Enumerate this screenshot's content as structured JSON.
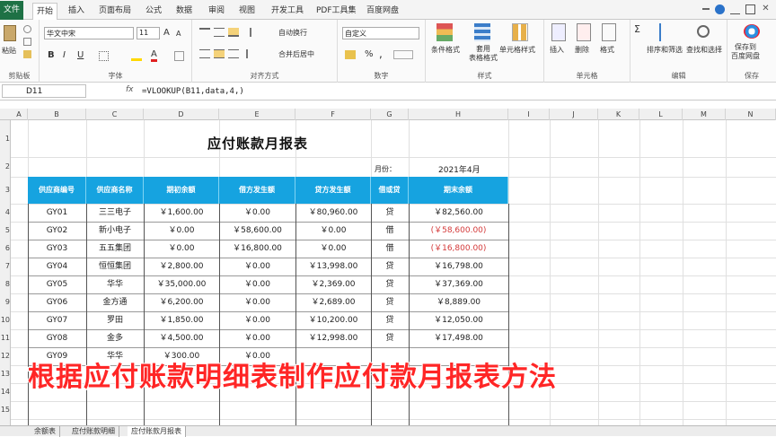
{
  "ribbon_tabs": {
    "file": "文件",
    "items": [
      "开始",
      "插入",
      "页面布局",
      "公式",
      "数据",
      "审阅",
      "视图",
      "开发工具",
      "PDF工具集",
      "百度网盘"
    ],
    "active": "开始"
  },
  "ribbon": {
    "clipboard": {
      "paste": "粘贴",
      "label": "剪贴板"
    },
    "font": {
      "name": "华文中宋",
      "size": "11",
      "label": "字体",
      "bold": "B",
      "italic": "I",
      "underline": "U",
      "font_color_glyph": "A",
      "grow": "A",
      "shrink": "A"
    },
    "align": {
      "wrap": "自动换行",
      "merge": "合并后居中",
      "label": "对齐方式"
    },
    "number": {
      "format": "自定义",
      "label": "数字",
      "percent": "%",
      "comma": ","
    },
    "styles": {
      "cond": "条件格式",
      "table": "套用\n表格格式",
      "cellstyle": "单元格样式",
      "label": "样式"
    },
    "cells": {
      "insert": "插入",
      "delete": "删除",
      "format": "格式",
      "label": "单元格"
    },
    "editing": {
      "sortfilter": "排序和筛选",
      "find": "查找和选择",
      "label": "编辑"
    },
    "save": {
      "cloud": "保存到\n百度网盘",
      "label": "保存"
    },
    "accent": "#1e7145"
  },
  "formula_bar": {
    "name_box": "D11",
    "fx": "fx",
    "formula": "=VLOOKUP(B11,data,4,)"
  },
  "columns": [
    "A",
    "B",
    "C",
    "D",
    "E",
    "F",
    "G",
    "H",
    "I",
    "J",
    "K",
    "L",
    "M",
    "N"
  ],
  "rows": [
    "1",
    "2",
    "3",
    "4",
    "5",
    "6",
    "7",
    "8",
    "9",
    "10",
    "11",
    "12",
    "13",
    "14",
    "15"
  ],
  "sheet": {
    "title": "应付账款月报表",
    "month_label": "月份：",
    "month_value": "2021年4月",
    "headers": [
      "供应商编号",
      "供应商名称",
      "期初余额",
      "借方发生额",
      "贷方发生额",
      "借或贷",
      "期末余额"
    ],
    "rows": [
      {
        "id": "GY01",
        "name": "三三电子",
        "open": "￥1,600.00",
        "debit": "￥0.00",
        "credit": "￥80,960.00",
        "dc": "贷",
        "close": "￥82,560.00",
        "neg": false
      },
      {
        "id": "GY02",
        "name": "新小电子",
        "open": "￥0.00",
        "debit": "￥58,600.00",
        "credit": "￥0.00",
        "dc": "借",
        "close": "(￥58,600.00)",
        "neg": true
      },
      {
        "id": "GY03",
        "name": "五五集团",
        "open": "￥0.00",
        "debit": "￥16,800.00",
        "credit": "￥0.00",
        "dc": "借",
        "close": "(￥16,800.00)",
        "neg": true
      },
      {
        "id": "GY04",
        "name": "恒恒集团",
        "open": "￥2,800.00",
        "debit": "￥0.00",
        "credit": "￥13,998.00",
        "dc": "贷",
        "close": "￥16,798.00",
        "neg": false
      },
      {
        "id": "GY05",
        "name": "华华",
        "open": "￥35,000.00",
        "debit": "￥0.00",
        "credit": "￥2,369.00",
        "dc": "贷",
        "close": "￥37,369.00",
        "neg": false
      },
      {
        "id": "GY06",
        "name": "金方通",
        "open": "￥6,200.00",
        "debit": "￥0.00",
        "credit": "￥2,689.00",
        "dc": "贷",
        "close": "￥8,889.00",
        "neg": false
      },
      {
        "id": "GY07",
        "name": "罗田",
        "open": "￥1,850.00",
        "debit": "￥0.00",
        "credit": "￥10,200.00",
        "dc": "贷",
        "close": "￥12,050.00",
        "neg": false
      },
      {
        "id": "GY08",
        "name": "金多",
        "open": "￥4,500.00",
        "debit": "￥0.00",
        "credit": "￥12,998.00",
        "dc": "贷",
        "close": "￥17,498.00",
        "neg": false
      },
      {
        "id": "GY09",
        "name": "华华",
        "open": "￥300.00",
        "debit": "￥0.00",
        "credit": "",
        "dc": "",
        "close": "",
        "neg": false
      }
    ]
  },
  "caption": "根据应付账款明细表制作应付款月报表方法",
  "sheet_tabs": [
    "余额表",
    "应付账款明细",
    "应付账款月报表"
  ],
  "active_sheet": "应付账款月报表",
  "colors": {
    "header_bg": "#16a3e0",
    "negative": "#d43a3a",
    "caption": "#ff2626"
  }
}
